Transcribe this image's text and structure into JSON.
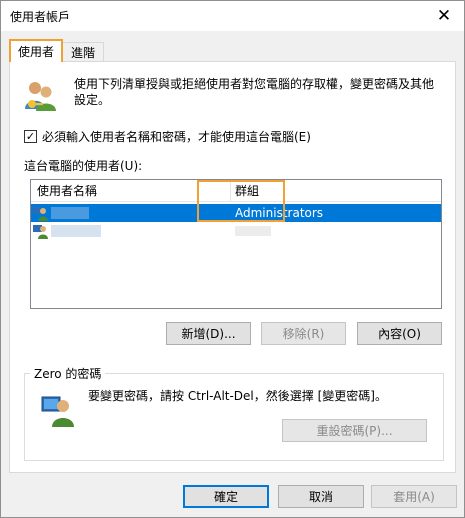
{
  "window": {
    "title": "使用者帳戶",
    "close_glyph": "✕"
  },
  "tabs": [
    {
      "label": "使用者"
    },
    {
      "label": "進階"
    }
  ],
  "intro": {
    "text": "使用下列清單授與或拒絕使用者對您電腦的存取權，變更密碼及其他設定。"
  },
  "require_password": {
    "label": "必須輸入使用者名稱和密碼，才能使用這台電腦(E)",
    "checked": true
  },
  "users_list": {
    "label": "這台電腦的使用者(U):",
    "columns": {
      "name": "使用者名稱",
      "group": "群組"
    },
    "rows": [
      {
        "group": "Administrators",
        "selected": true
      },
      {
        "group": "",
        "selected": false
      }
    ]
  },
  "list_buttons": {
    "add": "新增(D)...",
    "remove": "移除(R)",
    "properties": "內容(O)"
  },
  "password_box": {
    "title": "Zero 的密碼",
    "text": "要變更密碼，請按 Ctrl-Alt-Del，然後選擇 [變更密碼]。",
    "reset_button": "重設密碼(P)..."
  },
  "footer": {
    "ok": "確定",
    "cancel": "取消",
    "apply": "套用(A)"
  },
  "colors": {
    "highlight": "#f0a034",
    "selection": "#0078d7"
  }
}
